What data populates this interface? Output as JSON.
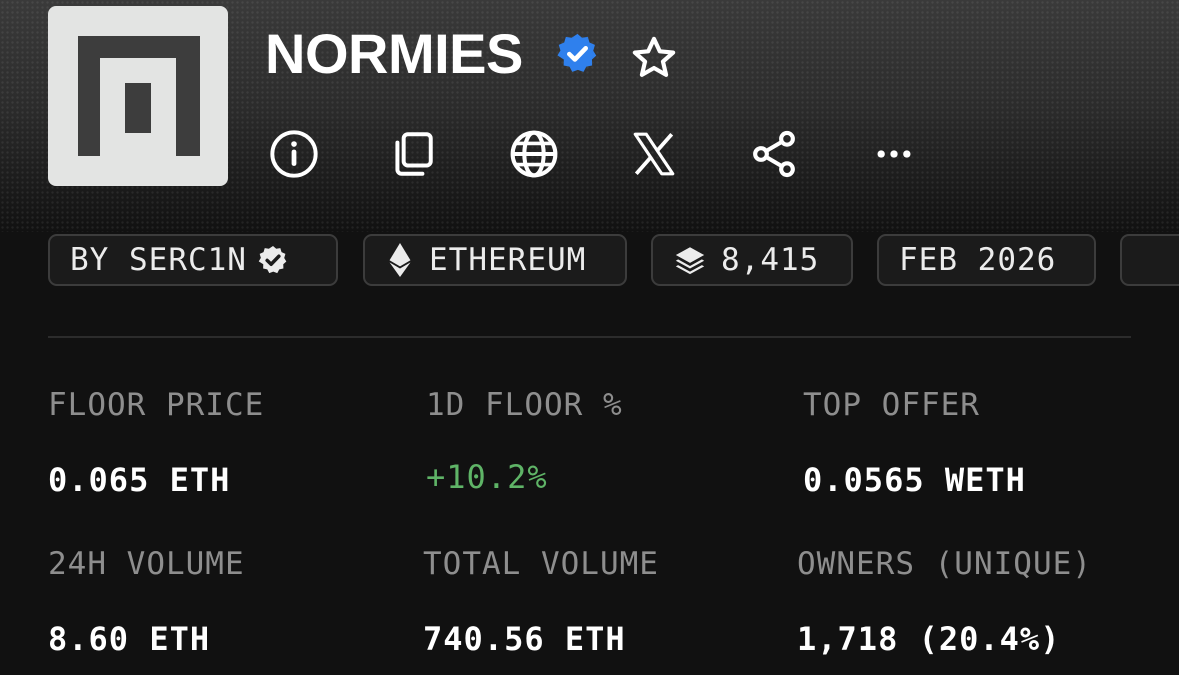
{
  "collection": {
    "name": "NORMIES",
    "logo": "normies-logo-icon",
    "verified_icon": "verified-badge-icon",
    "favorite_icon": "star-outline-icon"
  },
  "actions": [
    {
      "name": "info",
      "icon": "info-circle-icon"
    },
    {
      "name": "copy",
      "icon": "copy-icon"
    },
    {
      "name": "website",
      "icon": "globe-icon"
    },
    {
      "name": "x",
      "icon": "x-logo-icon"
    },
    {
      "name": "share",
      "icon": "share-icon"
    },
    {
      "name": "more",
      "icon": "more-horizontal-icon"
    }
  ],
  "tags": {
    "creator": "BY SERC1N",
    "creator_icon": "verified-check-icon",
    "chain": "ETHEREUM",
    "chain_icon": "ethereum-icon",
    "items": "8,415",
    "items_icon": "layers-icon",
    "date": "FEB 2026"
  },
  "stats": {
    "floor_price": {
      "label": "FLOOR PRICE",
      "value": "0.065 ETH"
    },
    "floor_change": {
      "label": "1D FLOOR %",
      "value": "+10.2%"
    },
    "top_offer": {
      "label": "TOP OFFER",
      "value": "0.0565 WETH"
    },
    "volume_24h": {
      "label": "24H VOLUME",
      "value": "8.60 ETH"
    },
    "total_volume": {
      "label": "TOTAL VOLUME",
      "value": "740.56 ETH"
    },
    "owners": {
      "label": "OWNERS (UNIQUE)",
      "value": "1,718 (20.4%)"
    }
  },
  "colors": {
    "background": "#111111",
    "verified_blue": "#2f80ed",
    "positive_green": "#5fb467",
    "label_gray": "#8e8e8e"
  }
}
